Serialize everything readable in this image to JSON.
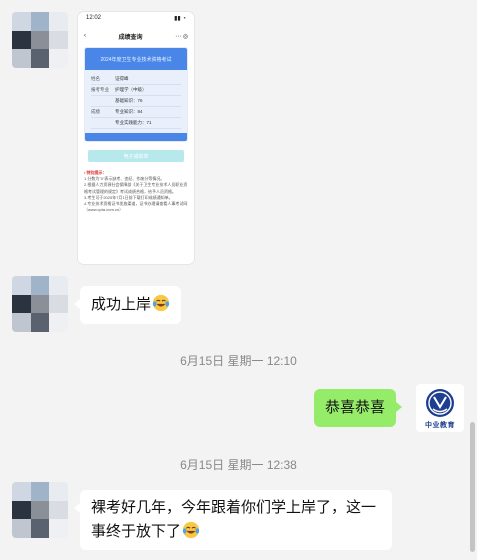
{
  "messages": [
    {
      "type": "image",
      "screenshot": {
        "status_time": "12:02",
        "nav_back": "‹",
        "nav_title": "成绩查询",
        "card_title": "2024年度卫生专业技术资格考试",
        "rows": [
          {
            "label": "姓名",
            "value": "证得峰"
          },
          {
            "label": "报考专业",
            "value": "护理学（中级）"
          },
          {
            "label": "",
            "value": "基础知识：76"
          },
          {
            "label": "成绩",
            "value": "专业知识：84"
          },
          {
            "label": "",
            "value": "专业实践能力：71"
          }
        ],
        "button": "电子成绩单",
        "tips_heading": "• 特别提示：",
        "tips": [
          "1.分数为\"0\"表示缺考、违纪、作废分等情况。",
          "2.根据人力资源社会保障部《关于卫生专业技术人员职业资格考试管理的规定》考试成绩合格，给予人员资格。",
          "3.考生可于2025年7月1日前下载打印成绩通知单。",
          "4.专业技术资格证书发放渠道，证书办理请查看人事考试网（www.cpta.com.cn）"
        ]
      }
    },
    {
      "type": "text",
      "side": "left",
      "text": "成功上岸",
      "emoji": "laughing-tears"
    },
    {
      "type": "time",
      "text": "6月15日 星期一 12:10"
    },
    {
      "type": "text",
      "side": "right",
      "text": "恭喜恭喜"
    },
    {
      "type": "time",
      "text": "6月15日 星期一 12:38"
    },
    {
      "type": "text",
      "side": "left",
      "text": "裸考好几年，今年跟着你们学上岸了，这一事终于放下了",
      "emoji": "laughing-tears"
    }
  ],
  "self_avatar": {
    "label": "中业教育"
  },
  "colors": {
    "bubble_right": "#95ec69",
    "bubble_left": "#ffffff",
    "background": "#f3f3f3"
  }
}
